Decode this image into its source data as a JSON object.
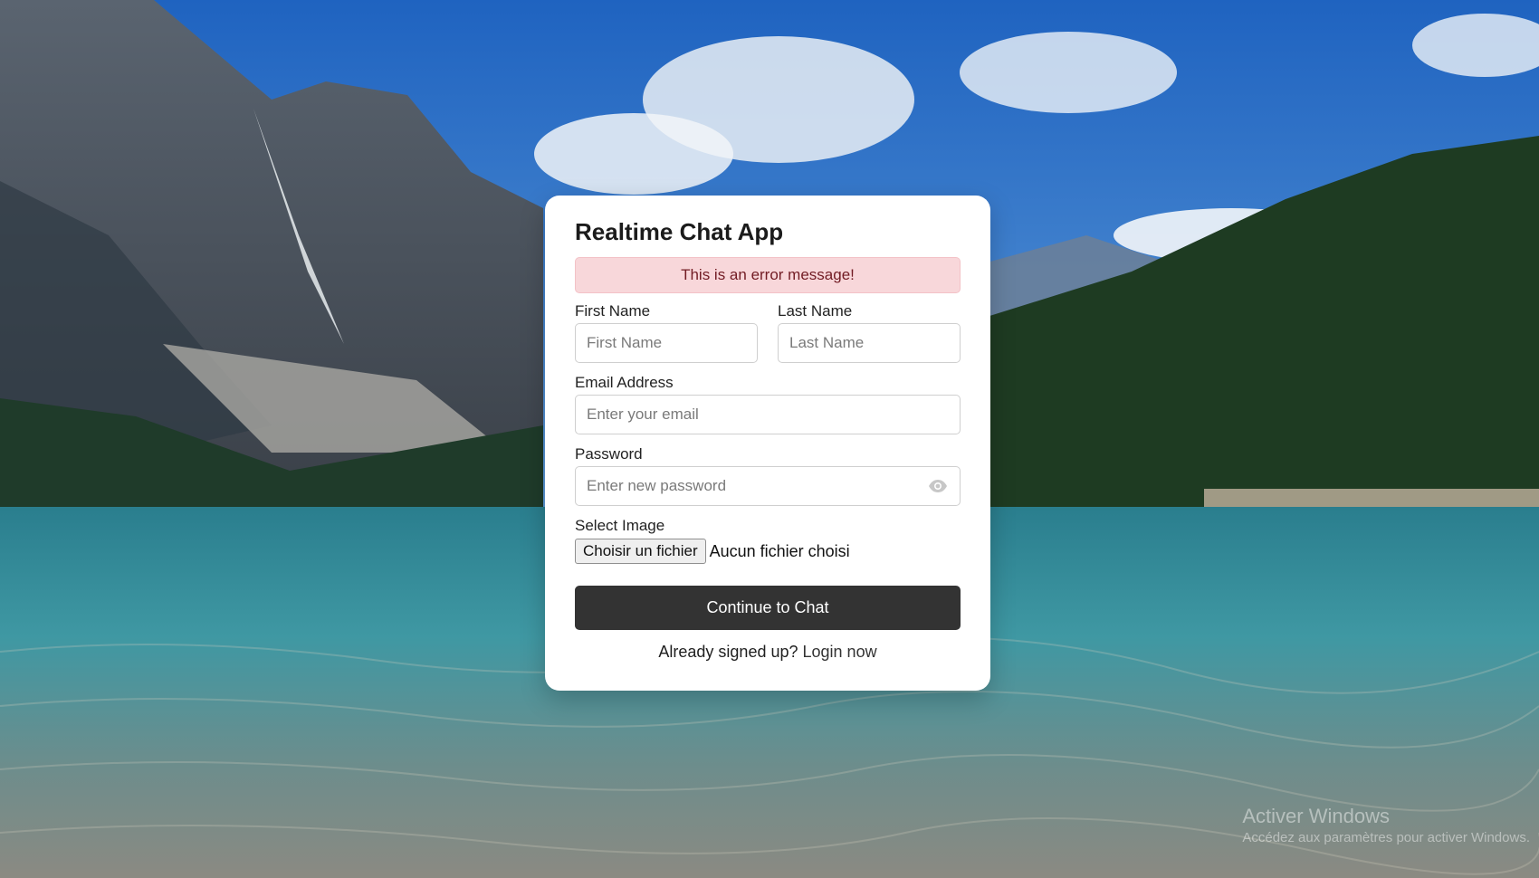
{
  "form": {
    "title": "Realtime Chat App",
    "error_message": "This is an error message!",
    "first_name": {
      "label": "First Name",
      "placeholder": "First Name",
      "value": ""
    },
    "last_name": {
      "label": "Last Name",
      "placeholder": "Last Name",
      "value": ""
    },
    "email": {
      "label": "Email Address",
      "placeholder": "Enter your email",
      "value": ""
    },
    "password": {
      "label": "Password",
      "placeholder": "Enter new password",
      "value": "",
      "toggle_icon": "eye-icon"
    },
    "image": {
      "label": "Select Image",
      "button_label": "Choisir un fichier",
      "status": "Aucun fichier choisi"
    },
    "submit_label": "Continue to Chat",
    "footer": {
      "text": "Already signed up?",
      "link": "Login now"
    }
  },
  "watermark": {
    "line1": "Activer Windows",
    "line2": "Accédez aux paramètres pour activer Windows."
  },
  "colors": {
    "error_bg": "#f8d7da",
    "error_text": "#721c24",
    "button_bg": "#333333",
    "card_bg": "#ffffff"
  }
}
